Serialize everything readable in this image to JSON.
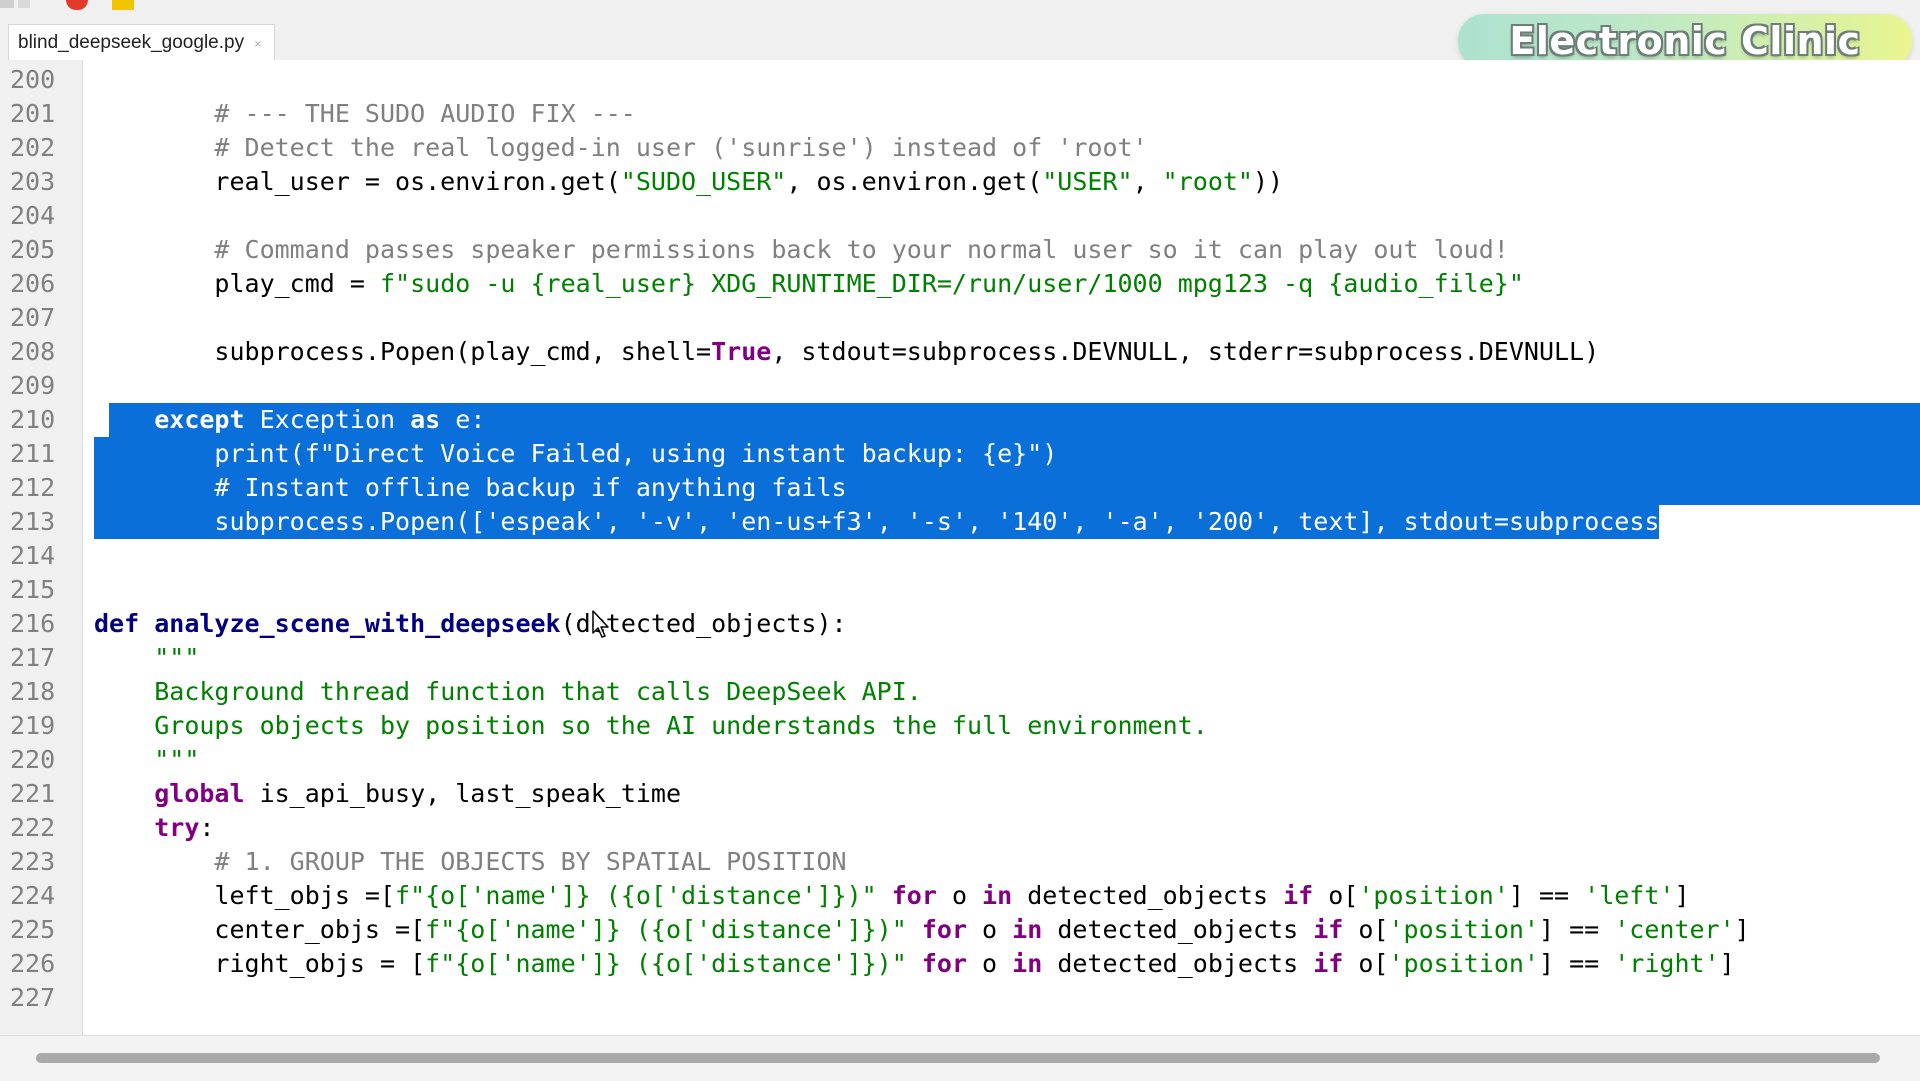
{
  "tab": {
    "filename": "blind_deepseek_google.py",
    "close_glyph": "×"
  },
  "watermark": {
    "text": "Electronic Clinic"
  },
  "colors": {
    "selection": "#0a6fd8",
    "keyword": "#800080",
    "string": "#008000",
    "comment": "#808080",
    "function": "#000080"
  },
  "editor": {
    "lines": [
      {
        "num": "200",
        "tokens": []
      },
      {
        "num": "201",
        "tokens": [
          {
            "t": "        "
          },
          {
            "t": "# --- THE SUDO AUDIO FIX ---",
            "c": "cmt"
          }
        ]
      },
      {
        "num": "202",
        "tokens": [
          {
            "t": "        "
          },
          {
            "t": "# Detect the real logged-in user ('sunrise') instead of 'root'",
            "c": "cmt"
          }
        ]
      },
      {
        "num": "203",
        "tokens": [
          {
            "t": "        real_user = os.environ.get("
          },
          {
            "t": "\"SUDO_USER\"",
            "c": "str"
          },
          {
            "t": ", os.environ.get("
          },
          {
            "t": "\"USER\"",
            "c": "str"
          },
          {
            "t": ", "
          },
          {
            "t": "\"root\"",
            "c": "str"
          },
          {
            "t": "))"
          }
        ]
      },
      {
        "num": "204",
        "tokens": []
      },
      {
        "num": "205",
        "tokens": [
          {
            "t": "        "
          },
          {
            "t": "# Command passes speaker permissions back to your normal user so it can play out loud!",
            "c": "cmt"
          }
        ]
      },
      {
        "num": "206",
        "tokens": [
          {
            "t": "        play_cmd = "
          },
          {
            "t": "f\"sudo -u {real_user} XDG_RUNTIME_DIR=/run/user/1000 mpg123 -q {audio_file}\"",
            "c": "str"
          }
        ]
      },
      {
        "num": "207",
        "tokens": []
      },
      {
        "num": "208",
        "tokens": [
          {
            "t": "        subprocess.Popen(play_cmd, shell="
          },
          {
            "t": "True",
            "c": "kw"
          },
          {
            "t": ", stdout=subprocess.DEVNULL, stderr=subprocess.DEVNULL)"
          }
        ]
      },
      {
        "num": "209",
        "tokens": []
      },
      {
        "num": "210",
        "selected": true,
        "sel_start": 1,
        "tokens": [
          {
            "t": "    "
          },
          {
            "t": "except",
            "c": "kw"
          },
          {
            "t": " Exception "
          },
          {
            "t": "as",
            "c": "kw"
          },
          {
            "t": " e:"
          }
        ]
      },
      {
        "num": "211",
        "selected": true,
        "tokens": [
          {
            "t": "        print("
          },
          {
            "t": "f\"Direct Voice Failed, using instant backup: {e}\"",
            "c": "str"
          },
          {
            "t": ")"
          }
        ]
      },
      {
        "num": "212",
        "selected": true,
        "tokens": [
          {
            "t": "        "
          },
          {
            "t": "# Instant offline backup if anything fails",
            "c": "cmt"
          }
        ]
      },
      {
        "num": "213",
        "selected": true,
        "sel_end_col": 104,
        "tokens": [
          {
            "t": "        subprocess.Popen(["
          },
          {
            "t": "'espeak'",
            "c": "str"
          },
          {
            "t": ", "
          },
          {
            "t": "'-v'",
            "c": "str"
          },
          {
            "t": ", "
          },
          {
            "t": "'en-us+f3'",
            "c": "str"
          },
          {
            "t": ", "
          },
          {
            "t": "'-s'",
            "c": "str"
          },
          {
            "t": ", "
          },
          {
            "t": "'140'",
            "c": "str"
          },
          {
            "t": ", "
          },
          {
            "t": "'-a'",
            "c": "str"
          },
          {
            "t": ", "
          },
          {
            "t": "'200'",
            "c": "str"
          },
          {
            "t": ", text], stdout=subprocess.DEVNULL, st"
          }
        ]
      },
      {
        "num": "214",
        "tokens": []
      },
      {
        "num": "215",
        "tokens": []
      },
      {
        "num": "216",
        "tokens": [
          {
            "t": "def",
            "c": "kwdef"
          },
          {
            "t": " "
          },
          {
            "t": "analyze_scene_with_deepseek",
            "c": "fn"
          },
          {
            "t": "(detected_objects):"
          }
        ]
      },
      {
        "num": "217",
        "tokens": [
          {
            "t": "    "
          },
          {
            "t": "\"\"\"",
            "c": "doc"
          }
        ]
      },
      {
        "num": "218",
        "tokens": [
          {
            "t": "    "
          },
          {
            "t": "Background thread function that calls DeepSeek API.",
            "c": "doc"
          }
        ]
      },
      {
        "num": "219",
        "tokens": [
          {
            "t": "    "
          },
          {
            "t": "Groups objects by position so the AI understands the full environment.",
            "c": "doc"
          }
        ]
      },
      {
        "num": "220",
        "tokens": [
          {
            "t": "    "
          },
          {
            "t": "\"\"\"",
            "c": "doc"
          }
        ]
      },
      {
        "num": "221",
        "tokens": [
          {
            "t": "    "
          },
          {
            "t": "global",
            "c": "kw"
          },
          {
            "t": " is_api_busy, last_speak_time"
          }
        ]
      },
      {
        "num": "222",
        "tokens": [
          {
            "t": "    "
          },
          {
            "t": "try",
            "c": "kw"
          },
          {
            "t": ":"
          }
        ]
      },
      {
        "num": "223",
        "tokens": [
          {
            "t": "        "
          },
          {
            "t": "# 1. GROUP THE OBJECTS BY SPATIAL POSITION",
            "c": "cmt"
          }
        ]
      },
      {
        "num": "224",
        "tokens": [
          {
            "t": "        left_objs =["
          },
          {
            "t": "f\"{o['name']} ({o['distance']})\"",
            "c": "str"
          },
          {
            "t": " "
          },
          {
            "t": "for",
            "c": "kw"
          },
          {
            "t": " o "
          },
          {
            "t": "in",
            "c": "kw"
          },
          {
            "t": " detected_objects "
          },
          {
            "t": "if",
            "c": "kw"
          },
          {
            "t": " o["
          },
          {
            "t": "'position'",
            "c": "str"
          },
          {
            "t": "] == "
          },
          {
            "t": "'left'",
            "c": "str"
          },
          {
            "t": "]"
          }
        ]
      },
      {
        "num": "225",
        "tokens": [
          {
            "t": "        center_objs =["
          },
          {
            "t": "f\"{o['name']} ({o['distance']})\"",
            "c": "str"
          },
          {
            "t": " "
          },
          {
            "t": "for",
            "c": "kw"
          },
          {
            "t": " o "
          },
          {
            "t": "in",
            "c": "kw"
          },
          {
            "t": " detected_objects "
          },
          {
            "t": "if",
            "c": "kw"
          },
          {
            "t": " o["
          },
          {
            "t": "'position'",
            "c": "str"
          },
          {
            "t": "] == "
          },
          {
            "t": "'center'",
            "c": "str"
          },
          {
            "t": "]"
          }
        ]
      },
      {
        "num": "226",
        "tokens": [
          {
            "t": "        right_objs = ["
          },
          {
            "t": "f\"{o['name']} ({o['distance']})\"",
            "c": "str"
          },
          {
            "t": " "
          },
          {
            "t": "for",
            "c": "kw"
          },
          {
            "t": " o "
          },
          {
            "t": "in",
            "c": "kw"
          },
          {
            "t": " detected_objects "
          },
          {
            "t": "if",
            "c": "kw"
          },
          {
            "t": " o["
          },
          {
            "t": "'position'",
            "c": "str"
          },
          {
            "t": "] == "
          },
          {
            "t": "'right'",
            "c": "str"
          },
          {
            "t": "]"
          }
        ]
      },
      {
        "num": "227",
        "tokens": []
      }
    ]
  }
}
